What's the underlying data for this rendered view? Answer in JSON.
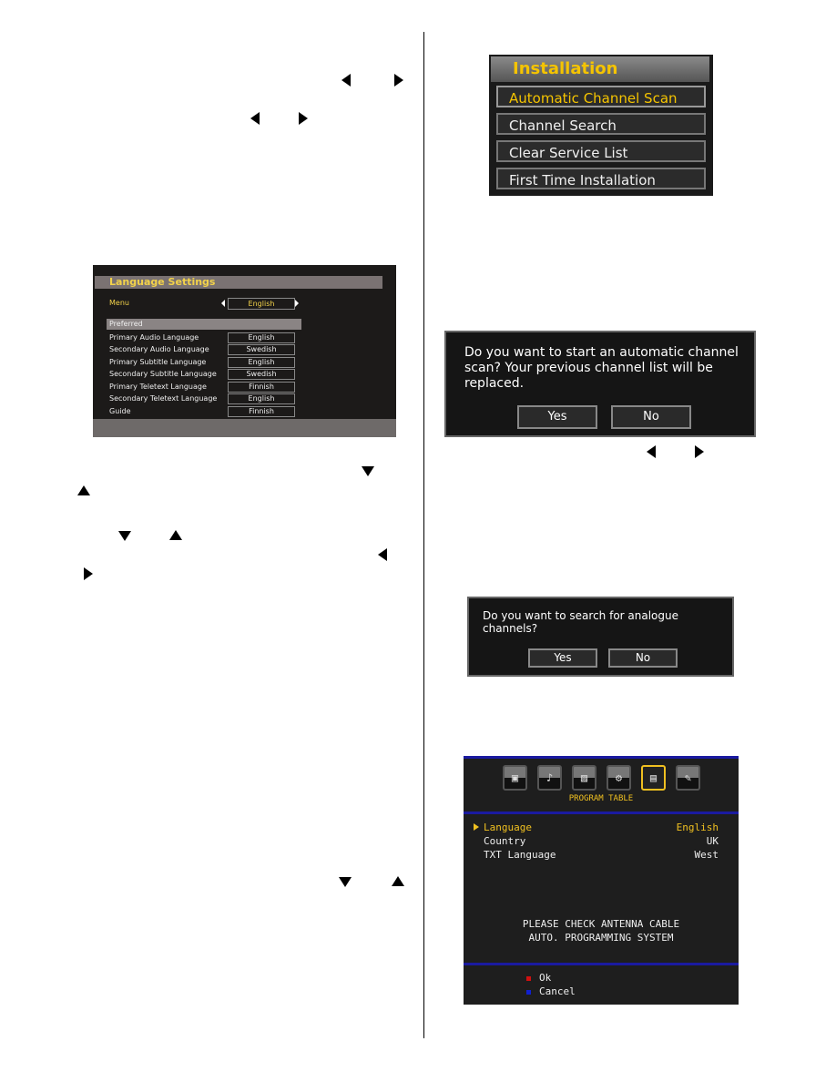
{
  "arrows_icons": [
    "left-arrow",
    "right-arrow",
    "down-arrow",
    "up-arrow"
  ],
  "language_settings": {
    "title": "Language Settings",
    "menu_label": "Menu",
    "menu_value": "English",
    "preferred_header": "Preferred",
    "rows": [
      {
        "label": "Primary Audio Language",
        "value": "English"
      },
      {
        "label": "Secondary Audio Language",
        "value": "Swedish"
      },
      {
        "label": "Primary Subtitle Language",
        "value": "English"
      },
      {
        "label": "Secondary Subtitle Language",
        "value": "Swedish"
      },
      {
        "label": "Primary Teletext Language",
        "value": "Finnish"
      },
      {
        "label": "Secondary Teletext Language",
        "value": "English"
      },
      {
        "label": "Guide",
        "value": "Finnish"
      }
    ]
  },
  "installation": {
    "title": "Installation",
    "items": [
      "Automatic Channel Scan",
      "Channel Search",
      "Clear Service List",
      "First Time Installation"
    ],
    "selected_index": 0
  },
  "dialog_auto_scan": {
    "message": "Do you want to start an automatic channel scan? Your previous channel list will be replaced.",
    "yes": "Yes",
    "no": "No"
  },
  "dialog_analogue": {
    "message": "Do you want to search for analogue channels?",
    "yes": "Yes",
    "no": "No"
  },
  "program_table": {
    "header": "PROGRAM TABLE",
    "icons": [
      "camera-icon",
      "music-icon",
      "picture-icon",
      "settings-icon",
      "program-table-icon",
      "tools-icon"
    ],
    "selected_icon": 4,
    "rows": [
      {
        "label": "Language",
        "value": "English"
      },
      {
        "label": "Country",
        "value": "UK"
      },
      {
        "label": "TXT Language",
        "value": "West"
      }
    ],
    "notice_line1": "PLEASE CHECK ANTENNA CABLE",
    "notice_line2": "AUTO. PROGRAMMING SYSTEM",
    "ok_label": "Ok",
    "cancel_label": "Cancel",
    "ok_color": "#d01010",
    "cancel_color": "#1020d0",
    "accent_color": "#f0c020"
  }
}
